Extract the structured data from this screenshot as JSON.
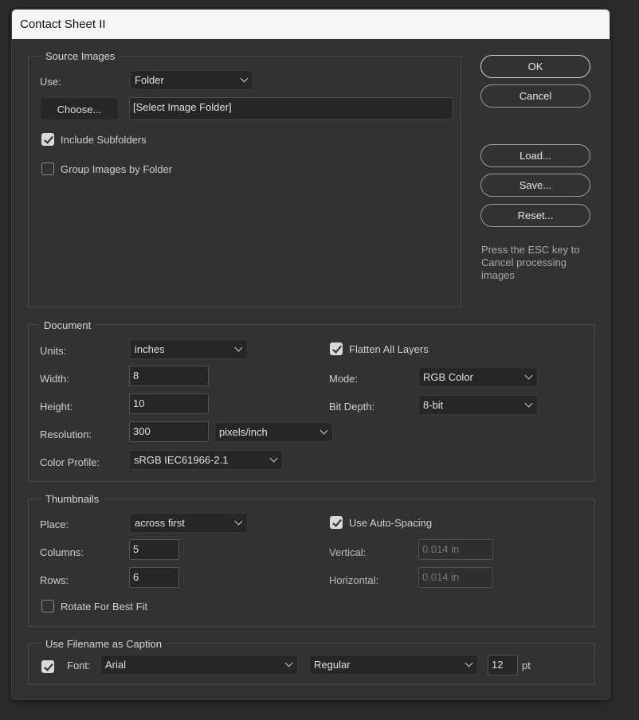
{
  "window": {
    "title": "Contact Sheet II"
  },
  "buttons": {
    "ok": "OK",
    "cancel": "Cancel",
    "load": "Load...",
    "save": "Save...",
    "reset": "Reset..."
  },
  "note": "Press the ESC key to Cancel processing images",
  "source_images": {
    "legend": "Source Images",
    "use_label": "Use:",
    "use_value": "Folder",
    "choose_label": "Choose...",
    "folder_path": "[Select Image Folder]",
    "include_subfolders": {
      "label": "Include Subfolders",
      "checked": true
    },
    "group_by_folder": {
      "label": "Group Images by Folder",
      "checked": false
    }
  },
  "document": {
    "legend": "Document",
    "units_label": "Units:",
    "units_value": "inches",
    "width_label": "Width:",
    "width_value": "8",
    "height_label": "Height:",
    "height_value": "10",
    "resolution_label": "Resolution:",
    "resolution_value": "300",
    "resolution_unit": "pixels/inch",
    "color_profile_label": "Color Profile:",
    "color_profile_value": "sRGB IEC61966-2.1",
    "flatten_label": "Flatten All Layers",
    "flatten_checked": true,
    "mode_label": "Mode:",
    "mode_value": "RGB Color",
    "bit_depth_label": "Bit Depth:",
    "bit_depth_value": "8-bit"
  },
  "thumbnails": {
    "legend": "Thumbnails",
    "place_label": "Place:",
    "place_value": "across first",
    "columns_label": "Columns:",
    "columns_value": "5",
    "rows_label": "Rows:",
    "rows_value": "6",
    "rotate_label": "Rotate For Best Fit",
    "rotate_checked": false,
    "auto_spacing_label": "Use Auto-Spacing",
    "auto_spacing_checked": true,
    "vertical_label": "Vertical:",
    "vertical_value": "0.014 in",
    "horizontal_label": "Horizontal:",
    "horizontal_value": "0.014 in"
  },
  "caption": {
    "legend": "Use Filename as Caption",
    "enabled": true,
    "font_label": "Font:",
    "font_value": "Arial",
    "style_value": "Regular",
    "size_value": "12",
    "size_unit": "pt"
  }
}
